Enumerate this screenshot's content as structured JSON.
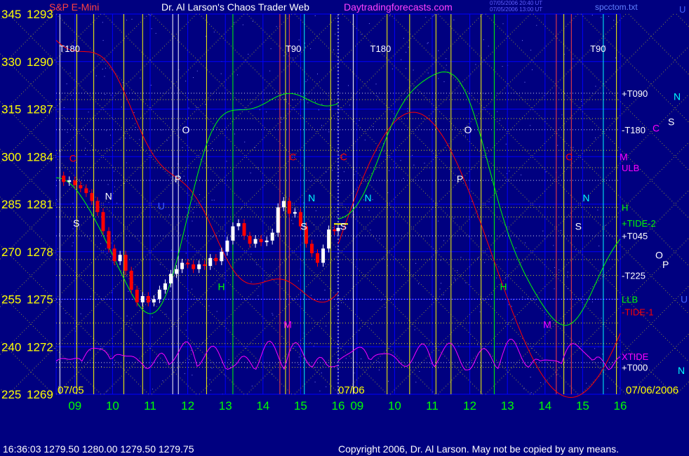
{
  "header": {
    "instrument": "S&P E-Mini",
    "instrument_color": "#ff4040",
    "title": "Dr. Al Larson's Chaos Trader Web",
    "site": "Daytradingforecasts.com",
    "site_color": "#ff40ff",
    "stamp_line1": "07/05/2006 20:40 UT",
    "stamp_line2": "07/05/2006 13:00 UT",
    "file": "spcctom.txt",
    "right_marker": "U"
  },
  "footer": {
    "quote": "16:36:03  1279.50 1280.00 1279.50 1279.75",
    "copyright": "Copyright 2006, Dr. Al Larson. May not be copied by any means."
  },
  "colors": {
    "background": "#000080",
    "grid": "#0000ff",
    "price": "#ffffff",
    "down": "#ff0000",
    "green": "#00ff00",
    "red": "#ff0000",
    "magenta": "#ff00ff",
    "yellow": "#ffff00",
    "cyan": "#00ffff",
    "blue": "#4060ff",
    "axis_text": "#ffff00",
    "hour_text": "#00ff00"
  },
  "chart_data": {
    "type": "candlestick",
    "title": "S&P E-Mini",
    "y_left_degrees": [
      345,
      330,
      315,
      300,
      285,
      270,
      255,
      240,
      225
    ],
    "y_right_prices": [
      1293,
      1290,
      1287,
      1284,
      1281,
      1278,
      1275,
      1272,
      1269
    ],
    "ylim": [
      1269,
      1293
    ],
    "x_hours_day1": [
      "09",
      "10",
      "11",
      "12",
      "13",
      "14",
      "15",
      "16"
    ],
    "x_hours_day2": [
      "09",
      "10",
      "11",
      "12",
      "13",
      "14",
      "15",
      "16"
    ],
    "xlim_hours": [
      8.5,
      16
    ],
    "date_labels": [
      "07/05",
      "07/06",
      "07/06/2006"
    ],
    "right_labels": [
      {
        "text": "+T090",
        "price": 1288.0,
        "color": "#ffffff"
      },
      {
        "text": "-T180",
        "price": 1285.7,
        "color": "#ffffff"
      },
      {
        "text": "ULB",
        "price": 1283.3,
        "color": "#ff00ff"
      },
      {
        "text": "H",
        "price": 1280.8,
        "color": "#00ff00"
      },
      {
        "text": "+TIDE-2",
        "price": 1279.8,
        "color": "#00ff00"
      },
      {
        "text": "+T045",
        "price": 1279.0,
        "color": "#ffffff"
      },
      {
        "text": "-T225",
        "price": 1276.5,
        "color": "#ffffff"
      },
      {
        "text": "LLB",
        "price": 1275.0,
        "color": "#00ff00"
      },
      {
        "text": "-TIDE-1",
        "price": 1274.2,
        "color": "#ff0000"
      },
      {
        "text": "XTIDE",
        "price": 1271.4,
        "color": "#ff00ff"
      },
      {
        "text": "+T000",
        "price": 1270.7,
        "color": "#ffffff"
      }
    ],
    "far_right_letters": [
      {
        "text": "N",
        "price": 1287.8,
        "color": "#00ffff"
      },
      {
        "text": "S",
        "price": 1286.2,
        "color": "#ffffff"
      },
      {
        "text": "C",
        "price": 1285.8,
        "color": "#ff00ff"
      },
      {
        "text": "M",
        "price": 1284.0,
        "color": "#ff00ff"
      },
      {
        "text": "O",
        "price": 1277.8,
        "color": "#ffffff"
      },
      {
        "text": "P",
        "price": 1277.2,
        "color": "#ffffff"
      },
      {
        "text": "U",
        "price": 1275.0,
        "color": "#4060ff"
      },
      {
        "text": "N",
        "price": 1270.5,
        "color": "#00ffff"
      }
    ],
    "top_markers": [
      {
        "text": "T180",
        "day": 1,
        "hour": 8.58
      },
      {
        "text": "T90",
        "day": 1,
        "hour": 14.6
      },
      {
        "text": "T180",
        "day": 2,
        "hour": 9.35
      },
      {
        "text": "T90",
        "day": 2,
        "hour": 15.2
      }
    ],
    "in_chart_letters": [
      {
        "text": "N",
        "day": 1,
        "hour": 9.8,
        "price": 1281.5,
        "color": "#ffffff"
      },
      {
        "text": "S",
        "day": 1,
        "hour": 8.95,
        "price": 1279.8,
        "color": "#ffffff"
      },
      {
        "text": "C",
        "day": 1,
        "hour": 8.85,
        "price": 1283.9,
        "color": "#ff0000"
      },
      {
        "text": "U",
        "day": 1,
        "hour": 11.2,
        "price": 1280.9,
        "color": "#4060ff"
      },
      {
        "text": "O",
        "day": 1,
        "hour": 11.85,
        "price": 1285.7,
        "color": "#ffffff"
      },
      {
        "text": "P",
        "day": 1,
        "hour": 11.65,
        "price": 1282.6,
        "color": "#ffffff"
      },
      {
        "text": "H",
        "day": 1,
        "hour": 12.8,
        "price": 1275.8,
        "color": "#00ff00"
      },
      {
        "text": "C",
        "day": 1,
        "hour": 14.7,
        "price": 1284.0,
        "color": "#ff0000"
      },
      {
        "text": "N",
        "day": 1,
        "hour": 15.2,
        "price": 1281.4,
        "color": "#00ffff"
      },
      {
        "text": "S",
        "day": 1,
        "hour": 15.0,
        "price": 1279.6,
        "color": "#ffffff"
      },
      {
        "text": "M",
        "day": 1,
        "hour": 14.55,
        "price": 1273.4,
        "color": "#ff00ff"
      },
      {
        "text": "C",
        "day": 2,
        "hour": 8.55,
        "price": 1284.0,
        "color": "#ff0000"
      },
      {
        "text": "N",
        "day": 2,
        "hour": 9.2,
        "price": 1281.4,
        "color": "#00ffff"
      },
      {
        "text": "S",
        "day": 2,
        "hour": 8.55,
        "price": 1279.6,
        "color": "#ffffff"
      },
      {
        "text": "O",
        "day": 2,
        "hour": 11.85,
        "price": 1285.7,
        "color": "#ffffff"
      },
      {
        "text": "P",
        "day": 2,
        "hour": 11.65,
        "price": 1282.6,
        "color": "#ffffff"
      },
      {
        "text": "H",
        "day": 2,
        "hour": 12.8,
        "price": 1275.8,
        "color": "#00ff00"
      },
      {
        "text": "C",
        "day": 2,
        "hour": 14.55,
        "price": 1284.0,
        "color": "#ff0000"
      },
      {
        "text": "N",
        "day": 2,
        "hour": 15.0,
        "price": 1281.4,
        "color": "#00ffff"
      },
      {
        "text": "S",
        "day": 2,
        "hour": 14.8,
        "price": 1279.6,
        "color": "#ffffff"
      },
      {
        "text": "M",
        "day": 2,
        "hour": 13.95,
        "price": 1273.4,
        "color": "#ff00ff"
      }
    ],
    "vertical_markers": [
      {
        "day": 1,
        "hour": 8.6,
        "color": "#ffffff"
      },
      {
        "day": 1,
        "hour": 9.05,
        "color": "#ffff00"
      },
      {
        "day": 1,
        "hour": 9.5,
        "color": "#ffff00"
      },
      {
        "day": 1,
        "hour": 10.3,
        "color": "#ffff00"
      },
      {
        "day": 1,
        "hour": 10.8,
        "color": "#ffff00"
      },
      {
        "day": 1,
        "hour": 11.6,
        "color": "#ffffff"
      },
      {
        "day": 1,
        "hour": 11.75,
        "color": "#ffffff"
      },
      {
        "day": 1,
        "hour": 12.5,
        "color": "#ffff00"
      },
      {
        "day": 1,
        "hour": 13.2,
        "color": "#00ff00"
      },
      {
        "day": 1,
        "hour": 14.45,
        "color": "#ff4040"
      },
      {
        "day": 1,
        "hour": 14.6,
        "color": "#ffff00"
      },
      {
        "day": 1,
        "hour": 14.7,
        "color": "#ff4040"
      },
      {
        "day": 1,
        "hour": 15.1,
        "color": "#00ffff"
      },
      {
        "day": 1,
        "hour": 15.8,
        "color": "#ffff00"
      },
      {
        "day": 2,
        "hour": 8.9,
        "color": "#ffffff"
      },
      {
        "day": 2,
        "hour": 9.8,
        "color": "#ffff00"
      },
      {
        "day": 2,
        "hour": 10.4,
        "color": "#ffff00"
      },
      {
        "day": 2,
        "hour": 11.1,
        "color": "#ffff00"
      },
      {
        "day": 2,
        "hour": 11.5,
        "color": "#ffff00"
      },
      {
        "day": 2,
        "hour": 12.3,
        "color": "#ffff00"
      },
      {
        "day": 2,
        "hour": 12.65,
        "color": "#00ff00"
      },
      {
        "day": 2,
        "hour": 14.3,
        "color": "#ff4040"
      },
      {
        "day": 2,
        "hour": 14.5,
        "color": "#ffff00"
      },
      {
        "day": 2,
        "hour": 14.7,
        "color": "#ff4040"
      },
      {
        "day": 2,
        "hour": 15.55,
        "color": "#00ffff"
      },
      {
        "day": 2,
        "hour": 15.9,
        "color": "#ffff00"
      }
    ],
    "horizontal_levels": [
      1288.0,
      1287.6,
      1286.4,
      1285.7,
      1284.4,
      1283.3,
      1282.5,
      1280.8,
      1280.2,
      1279.0,
      1277.5,
      1276.5,
      1275.0,
      1273.5,
      1272.2,
      1271.0,
      1270.7
    ],
    "price_series": [
      {
        "hour": 8.55,
        "price": 1282.8
      },
      {
        "hour": 8.7,
        "price": 1282.4
      },
      {
        "hour": 8.85,
        "price": 1282.5
      },
      {
        "hour": 9.0,
        "price": 1282.2
      },
      {
        "hour": 9.15,
        "price": 1282.0
      },
      {
        "hour": 9.3,
        "price": 1281.7
      },
      {
        "hour": 9.45,
        "price": 1281.2
      },
      {
        "hour": 9.6,
        "price": 1280.5
      },
      {
        "hour": 9.75,
        "price": 1279.3
      },
      {
        "hour": 9.9,
        "price": 1278.2
      },
      {
        "hour": 10.05,
        "price": 1277.4
      },
      {
        "hour": 10.2,
        "price": 1277.8
      },
      {
        "hour": 10.35,
        "price": 1276.8
      },
      {
        "hour": 10.5,
        "price": 1275.6
      },
      {
        "hour": 10.65,
        "price": 1274.8
      },
      {
        "hour": 10.8,
        "price": 1275.2
      },
      {
        "hour": 10.95,
        "price": 1274.8
      },
      {
        "hour": 11.1,
        "price": 1275.0
      },
      {
        "hour": 11.25,
        "price": 1275.6
      },
      {
        "hour": 11.4,
        "price": 1276.0
      },
      {
        "hour": 11.55,
        "price": 1276.6
      },
      {
        "hour": 11.7,
        "price": 1276.9
      },
      {
        "hour": 11.85,
        "price": 1277.3
      },
      {
        "hour": 12.0,
        "price": 1277.2
      },
      {
        "hour": 12.15,
        "price": 1276.9
      },
      {
        "hour": 12.3,
        "price": 1277.2
      },
      {
        "hour": 12.45,
        "price": 1277.1
      },
      {
        "hour": 12.6,
        "price": 1277.6
      },
      {
        "hour": 12.75,
        "price": 1277.4
      },
      {
        "hour": 12.9,
        "price": 1278.0
      },
      {
        "hour": 13.05,
        "price": 1278.7
      },
      {
        "hour": 13.2,
        "price": 1279.6
      },
      {
        "hour": 13.35,
        "price": 1279.8
      },
      {
        "hour": 13.5,
        "price": 1279.0
      },
      {
        "hour": 13.65,
        "price": 1278.5
      },
      {
        "hour": 13.8,
        "price": 1278.8
      },
      {
        "hour": 13.95,
        "price": 1278.6
      },
      {
        "hour": 14.1,
        "price": 1278.7
      },
      {
        "hour": 14.25,
        "price": 1279.2
      },
      {
        "hour": 14.4,
        "price": 1280.8
      },
      {
        "hour": 14.55,
        "price": 1281.2
      },
      {
        "hour": 14.7,
        "price": 1280.4
      },
      {
        "hour": 14.85,
        "price": 1280.5
      },
      {
        "hour": 15.0,
        "price": 1279.6
      },
      {
        "hour": 15.15,
        "price": 1278.5
      },
      {
        "hour": 15.3,
        "price": 1277.9
      },
      {
        "hour": 15.45,
        "price": 1277.3
      },
      {
        "hour": 15.6,
        "price": 1278.2
      },
      {
        "hour": 15.75,
        "price": 1279.4
      },
      {
        "hour": 15.9,
        "price": 1279.3
      },
      {
        "hour": 16.0,
        "price": 1279.5
      }
    ],
    "last_price": 1279.75
  }
}
